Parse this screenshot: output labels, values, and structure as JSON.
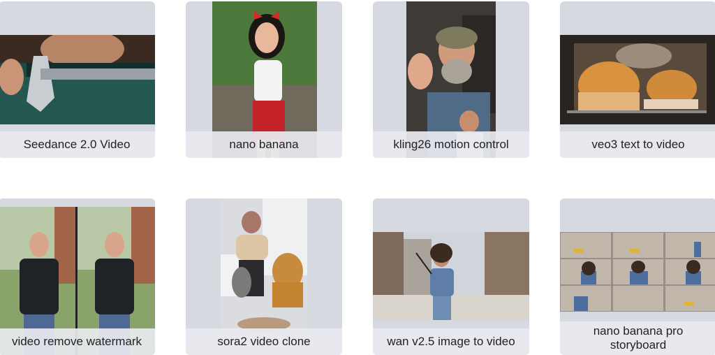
{
  "gallery": {
    "items": [
      {
        "label": "Seedance 2.0 Video"
      },
      {
        "label": "nano banana"
      },
      {
        "label": "kling26 motion control"
      },
      {
        "label": "veo3 text to video"
      },
      {
        "label": "video remove watermark"
      },
      {
        "label": "sora2 video clone"
      },
      {
        "label": "wan v2.5 image to video"
      },
      {
        "label": "nano banana pro storyboard"
      }
    ]
  }
}
